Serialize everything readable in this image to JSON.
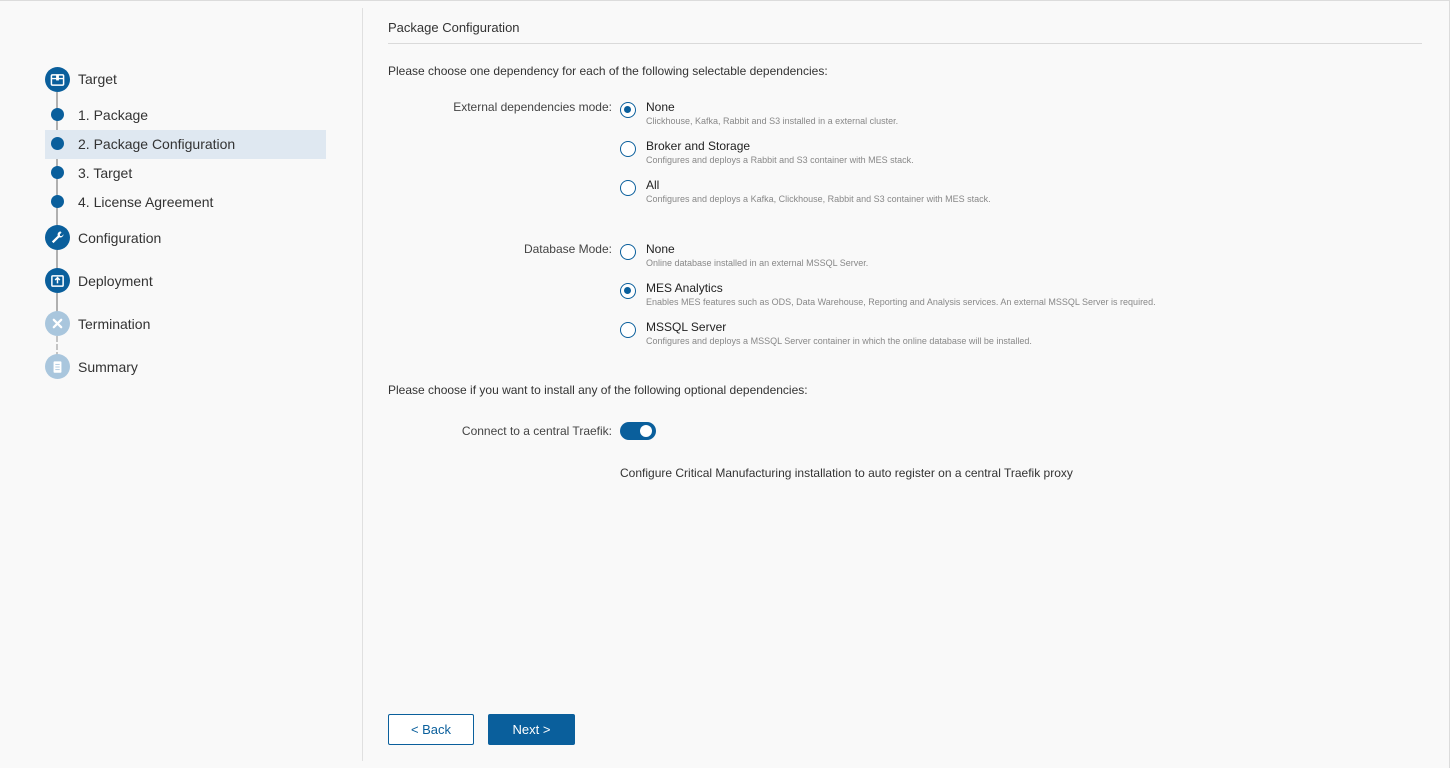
{
  "sidebar": {
    "steps": [
      {
        "label": "Target",
        "icon": "package-icon"
      },
      {
        "label": "1. Package"
      },
      {
        "label": "2. Package Configuration",
        "active": true
      },
      {
        "label": "3. Target"
      },
      {
        "label": "4. License Agreement"
      },
      {
        "label": "Configuration",
        "icon": "wrench-icon"
      },
      {
        "label": "Deployment",
        "icon": "upload-icon"
      },
      {
        "label": "Termination",
        "icon": "close-icon"
      },
      {
        "label": "Summary",
        "icon": "document-icon"
      }
    ]
  },
  "main": {
    "title": "Package Configuration",
    "instruction": "Please choose one dependency for each of the following selectable dependencies:",
    "external": {
      "label": "External dependencies mode:",
      "options": [
        {
          "label": "None",
          "desc": "Clickhouse, Kafka, Rabbit and S3 installed in a external cluster.",
          "checked": true
        },
        {
          "label": "Broker and Storage",
          "desc": "Configures and deploys a Rabbit and S3 container with MES stack.",
          "checked": false
        },
        {
          "label": "All",
          "desc": "Configures and deploys a Kafka, Clickhouse, Rabbit and S3 container with MES stack.",
          "checked": false
        }
      ]
    },
    "database": {
      "label": "Database Mode:",
      "options": [
        {
          "label": "None",
          "desc": "Online database installed in an external MSSQL Server.",
          "checked": false
        },
        {
          "label": "MES Analytics",
          "desc": "Enables MES features such as ODS, Data Warehouse, Reporting and Analysis services. An external MSSQL Server is required.",
          "checked": true
        },
        {
          "label": "MSSQL Server",
          "desc": "Configures and deploys a MSSQL Server container in which the online database will be installed.",
          "checked": false
        }
      ]
    },
    "optional_instruction": "Please choose if you want to install any of the following optional dependencies:",
    "traefik": {
      "label": "Connect to a central Traefik:",
      "enabled": true,
      "desc": "Configure Critical Manufacturing installation to auto register on a central Traefik proxy"
    }
  },
  "footer": {
    "back_label": "< Back",
    "next_label": "Next >"
  },
  "colors": {
    "accent": "#0a5f9c",
    "active_bg": "#dfe8f1",
    "inactive_icon": "#a9c6dd"
  }
}
